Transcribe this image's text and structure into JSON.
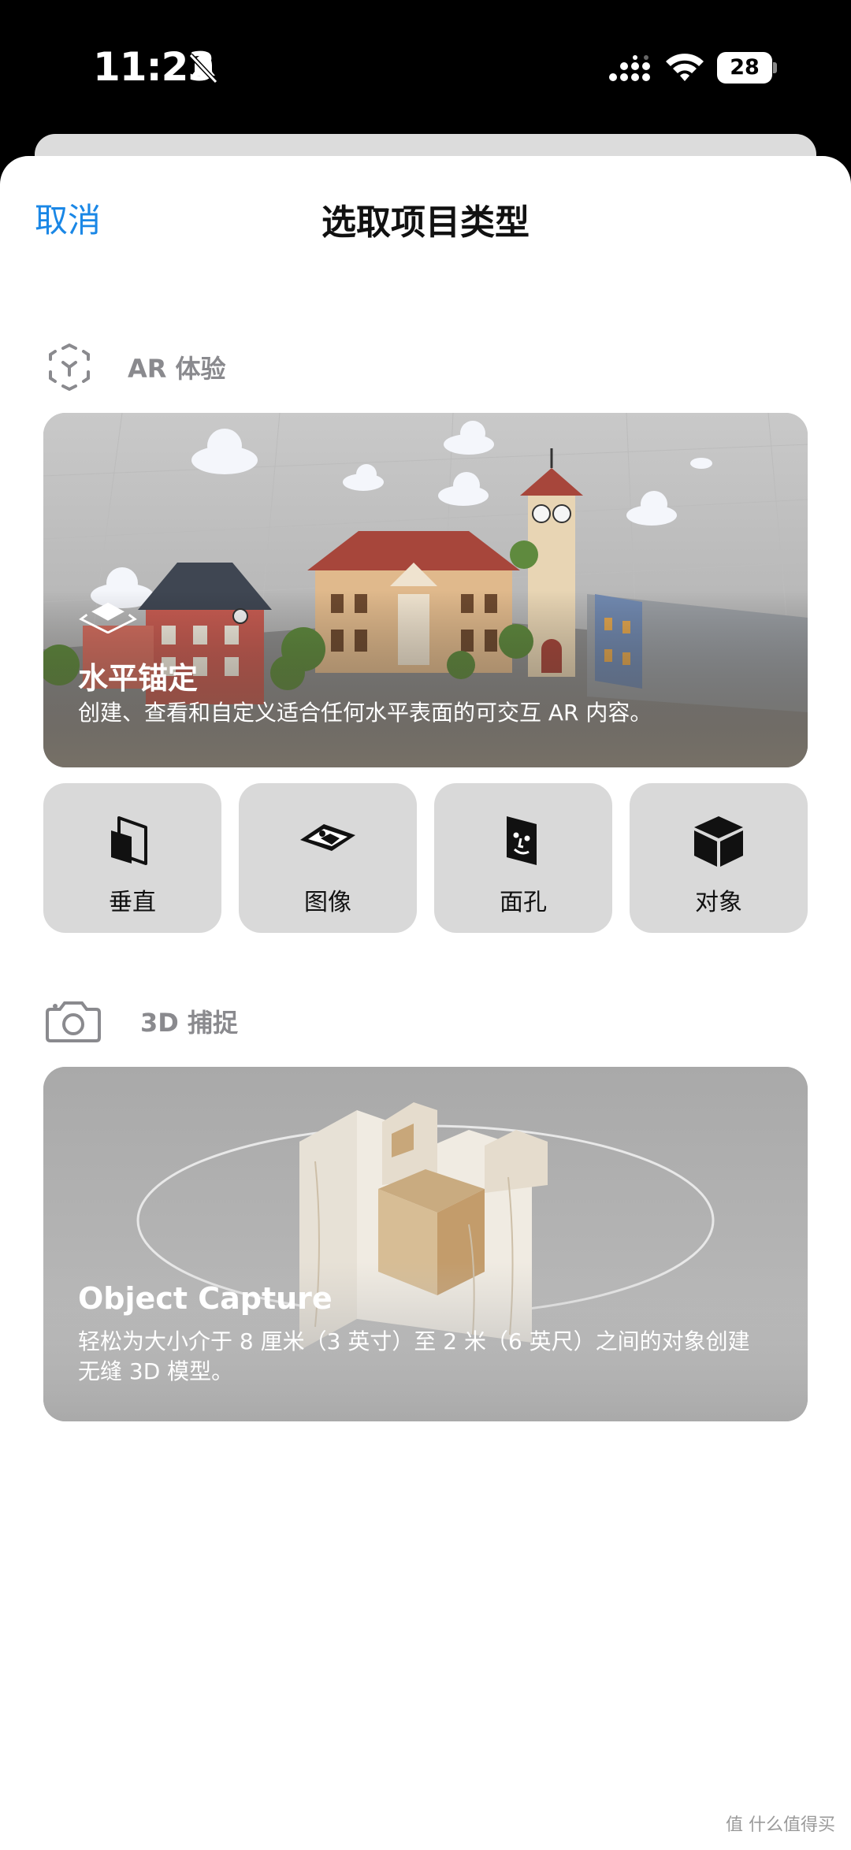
{
  "status_bar": {
    "time": "11:23",
    "battery": "28"
  },
  "sheet": {
    "cancel_label": "取消",
    "title": "选取项目类型"
  },
  "ar_section": {
    "label": "AR 体验",
    "icon": "ar-scan-icon",
    "featured": {
      "title": "水平锚定",
      "description": "创建、查看和自定义适合任何水平表面的可交互 AR 内容。",
      "icon": "horizontal-plane-icon"
    },
    "options": [
      {
        "label": "垂直",
        "icon": "vertical-plane-icon"
      },
      {
        "label": "图像",
        "icon": "image-anchor-icon"
      },
      {
        "label": "面孔",
        "icon": "face-anchor-icon"
      },
      {
        "label": "对象",
        "icon": "object-cube-icon"
      }
    ]
  },
  "capture_section": {
    "label": "3D 捕捉",
    "icon": "camera-icon",
    "featured": {
      "title": "Object Capture",
      "description": "轻松为大小介于 8 厘米（3 英寸）至 2 米（6 英尺）之间的对象创建无缝 3D 模型。"
    }
  },
  "watermark": "值 什么值得买",
  "colors": {
    "accent": "#1a87e6",
    "tile_bg": "#d9d9d9",
    "section_label": "#8a8a8e"
  }
}
